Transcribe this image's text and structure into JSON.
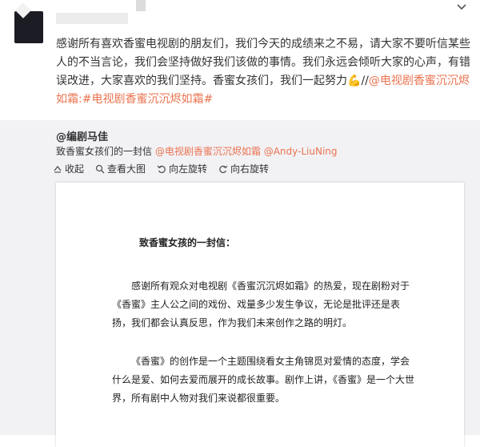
{
  "post": {
    "text_main": "感谢所有喜欢香蜜电视剧的朋友们，我们今天的成绩来之不易，请大家不要听信某些人的不当言论，我们会坚持做好我们该做的事情。我们永远会倾听大家的心声，有错误改进，大家喜欢的我们坚持。香蜜女孩们，我们一起努力",
    "emoji": "💪",
    "sep": "//",
    "mention_tv": "@电视剧香蜜沉沉烬如霜",
    "hashtag": ":#电视剧香蜜沉沉烬如霜#"
  },
  "repost": {
    "author": "@编剧马佳",
    "text_prefix": "致香蜜女孩们的一封信",
    "mention1": "@电视剧香蜜沉沉烬如霜",
    "mention2": "@Andy-LiuNing",
    "actions": {
      "collapse": "收起",
      "view_large": "查看大图",
      "rotate_left": "向左旋转",
      "rotate_right": "向右旋转"
    }
  },
  "letter": {
    "title": "致香蜜女孩的一封信：",
    "para1": "感谢所有观众对电视剧《香蜜沉沉烬如霜》的热爱，现在剧粉对于《香蜜》主人公之间的戏份、戏量多少发生争议，无论是批评还是表扬，我们都会认真反思，作为我们未来创作之路的明灯。",
    "para2": "《香蜜》的创作是一个主题围绕看女主角锦觅对爱情的态度，学会什么是爱、如何去爱而展开的成长故事。剧作上讲，《香蜜》是一个大世界，所有剧中人物对我们来说都很重要。"
  },
  "colors": {
    "link": "#eb7350",
    "repost_bg": "#f2f2f5"
  },
  "icons": {
    "menu": "chevron-down-icon"
  }
}
